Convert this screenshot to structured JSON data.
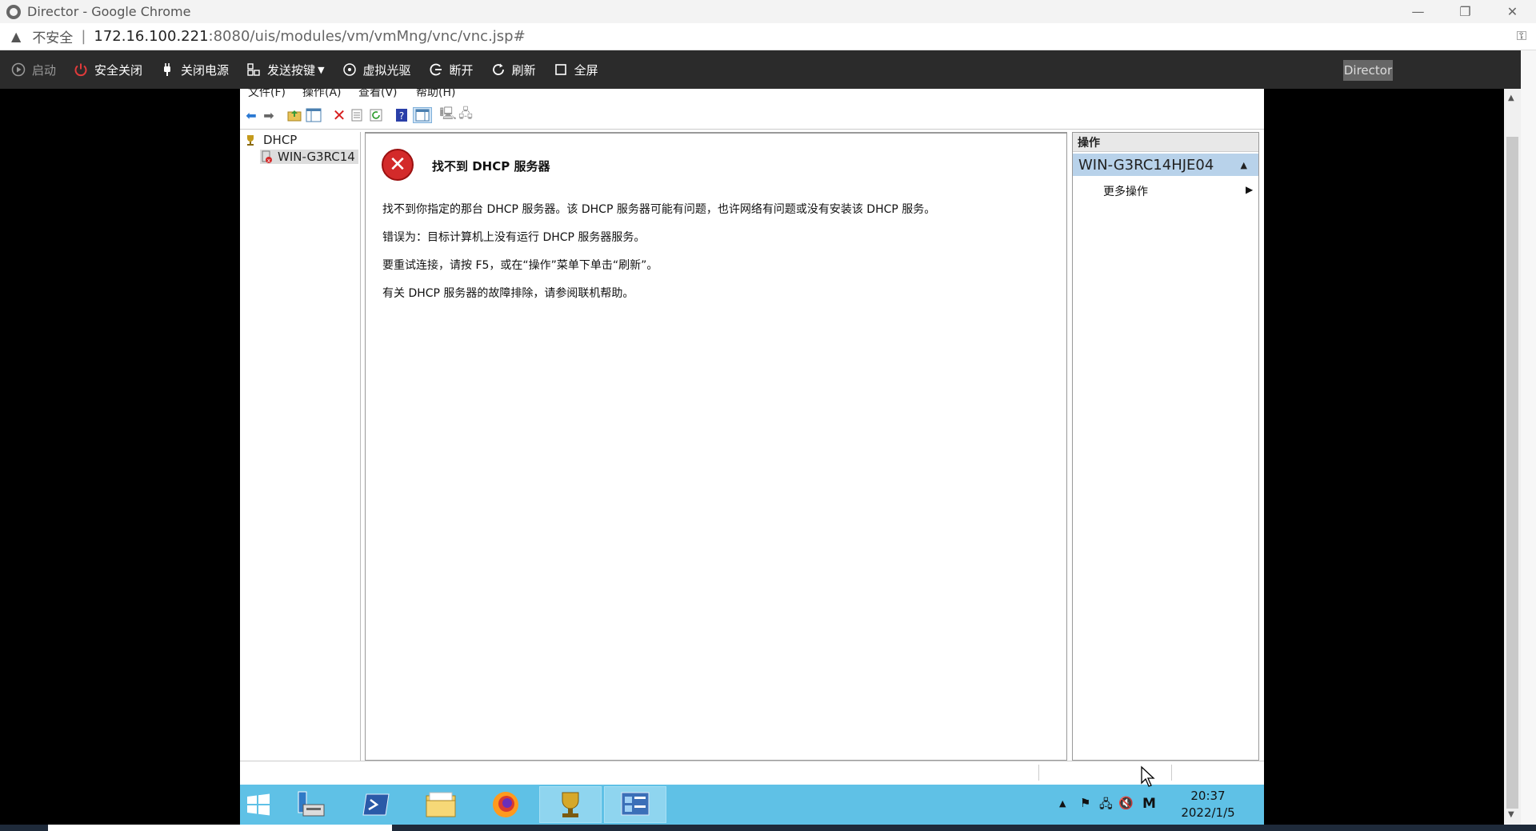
{
  "window": {
    "title": "Director - Google Chrome",
    "controls": [
      "—",
      "❐",
      "✕"
    ]
  },
  "address": {
    "insecure_label": "不安全",
    "url_host": "172.16.100.221",
    "url_rest": ":8080/uis/modules/vm/vmMng/vnc/vnc.jsp#"
  },
  "vnc_toolbar": {
    "start": "启动",
    "safe_shutdown": "安全关闭",
    "power_off": "关闭电源",
    "send_keys": "发送按键",
    "virtual_cd": "虚拟光驱",
    "disconnect": "断开",
    "refresh": "刷新",
    "fullscreen": "全屏",
    "director": "Director"
  },
  "mmc": {
    "menu": [
      "文件(F)",
      "操作(A)",
      "查看(V)",
      "帮助(H)"
    ],
    "tree": {
      "root": "DHCP",
      "server": "WIN-G3RC14"
    },
    "error": {
      "title": "找不到 DHCP 服务器",
      "line1": "找不到你指定的那台 DHCP 服务器。该 DHCP 服务器可能有问题，也许网络有问题或没有安装该 DHCP 服务。",
      "line2": "错误为：目标计算机上没有运行 DHCP 服务器服务。",
      "line3": "要重试连接，请按 F5，或在“操作”菜单下单击“刷新”。",
      "line4": "有关 DHCP 服务器的故障排除，请参阅联机帮助。"
    },
    "actions": {
      "header": "操作",
      "server": "WIN-G3RC14HJE04",
      "more": "更多操作"
    }
  },
  "taskbar": {
    "time": "20:37",
    "date": "2022/1/5",
    "ime": "M"
  }
}
